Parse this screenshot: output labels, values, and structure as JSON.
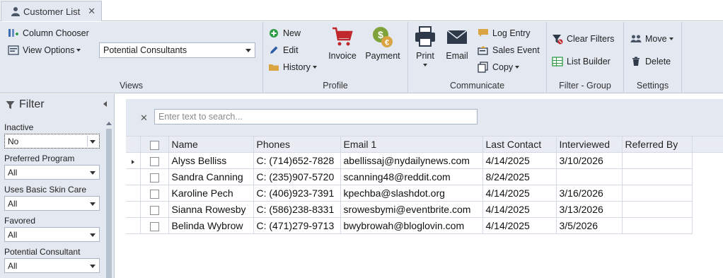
{
  "tab": {
    "label": "Customer List",
    "close": "✕",
    "icon": "user-icon"
  },
  "ribbon": {
    "views": {
      "column_chooser": "Column Chooser",
      "view_options": "View Options",
      "view_select": "Potential Consultants",
      "group_label": "Views"
    },
    "profile": {
      "new": "New",
      "edit": "Edit",
      "history": "History",
      "invoice": "Invoice",
      "payment": "Payment",
      "group_label": "Profile"
    },
    "communicate": {
      "print": "Print",
      "email": "Email",
      "log_entry": "Log Entry",
      "sales_event": "Sales Event",
      "copy": "Copy",
      "group_label": "Communicate"
    },
    "filter_group": {
      "clear_filters": "Clear Filters",
      "list_builder": "List Builder",
      "group_label": "Filter - Group"
    },
    "settings": {
      "move": "Move",
      "delete": "Delete",
      "group_label": "Settings"
    }
  },
  "filter": {
    "title": "Filter",
    "fields": [
      {
        "label": "Inactive",
        "value": "No"
      },
      {
        "label": "Preferred Program",
        "value": "All"
      },
      {
        "label": "Uses Basic Skin Care",
        "value": "All"
      },
      {
        "label": "Favored",
        "value": "All"
      },
      {
        "label": "Potential Consultant",
        "value": "All"
      }
    ]
  },
  "search": {
    "placeholder": "Enter text to search...",
    "clear": "✕"
  },
  "grid": {
    "columns": [
      "Name",
      "Phones",
      "Email 1",
      "Last Contact",
      "Interviewed",
      "Referred By"
    ],
    "rows": [
      {
        "name": "Alyss Belliss",
        "phones": "C: (714)652-7828",
        "email": "abellissaj@nydailynews.com",
        "last_contact": "4/14/2025",
        "interviewed": "3/10/2026",
        "referred_by": ""
      },
      {
        "name": "Sandra Canning",
        "phones": "C: (235)907-5720",
        "email": "scanning48@reddit.com",
        "last_contact": "8/24/2025",
        "interviewed": "",
        "referred_by": ""
      },
      {
        "name": "Karoline Pech",
        "phones": "C: (406)923-7391",
        "email": "kpechba@slashdot.org",
        "last_contact": "4/14/2025",
        "interviewed": "3/16/2026",
        "referred_by": ""
      },
      {
        "name": "Sianna Rowesby",
        "phones": "C: (586)238-8331",
        "email": "srowesbymi@eventbrite.com",
        "last_contact": "4/14/2025",
        "interviewed": "3/13/2026",
        "referred_by": ""
      },
      {
        "name": "Belinda Wybrow",
        "phones": "C: (471)279-9713",
        "email": "bwybrowah@bloglovin.com",
        "last_contact": "4/14/2025",
        "interviewed": "3/5/2026",
        "referred_by": ""
      }
    ]
  },
  "colors": {
    "ribbon_bg": "#e3e8f1",
    "border": "#b9c4d3",
    "invoice_red": "#c0272d",
    "payment_green": "#7fa23a"
  }
}
